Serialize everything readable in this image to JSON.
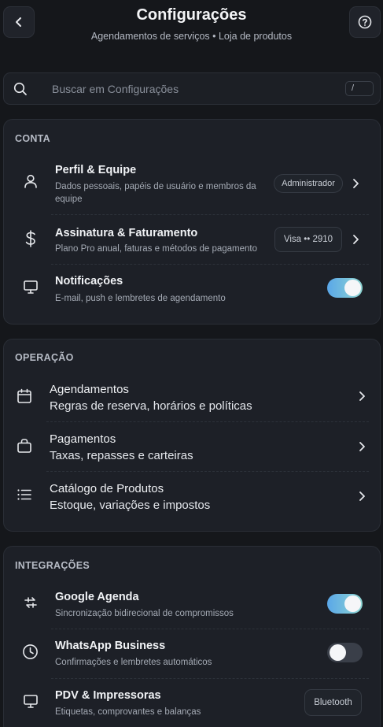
{
  "header": {
    "title": "Configurações",
    "subtitle": "Agendamentos de serviços • Loja de produtos"
  },
  "search": {
    "placeholder": "Buscar em Configurações",
    "shortcut": "/"
  },
  "conta": {
    "section_title": "CONTA",
    "items": [
      {
        "title": "Perfil & Equipe",
        "desc_line1": "Dados pessoais, papéis de usuário e membros da",
        "desc_line2": "equipe",
        "badge": "Administrador",
        "icon": "user-icon"
      },
      {
        "title": "Assinatura & Faturamento",
        "desc": "Plano Pro anual, faturas e métodos de pagamento",
        "badge": "Visa •• 2910",
        "icon": "dollar-icon"
      },
      {
        "title": "Notificações",
        "desc": "E-mail, push e lembretes de agendamento",
        "toggle_on": true,
        "icon": "monitor-icon"
      }
    ]
  },
  "operacao": {
    "section_title": "OPERAÇÃO",
    "items": [
      {
        "title": "Agendamentos",
        "desc": "Regras de reserva, horários e políticas",
        "icon": "calendar-icon"
      },
      {
        "title": "Pagamentos",
        "desc": "Taxas, repasses e carteiras",
        "icon": "bag-icon"
      },
      {
        "title": "Catálogo de Produtos",
        "desc": "Estoque, variações e impostos",
        "icon": "list-icon"
      }
    ]
  },
  "integracoes": {
    "section_title": "INTEGRAÇÕES",
    "items": [
      {
        "title": "Google Agenda",
        "desc": "Sincronização bidirecional de compromissos",
        "toggle_on": true,
        "icon": "sync-icon"
      },
      {
        "title": "WhatsApp Business",
        "desc": "Confirmações e lembretes automáticos",
        "toggle_on": false,
        "icon": "clock-icon"
      },
      {
        "title": "PDV & Impressoras",
        "desc": "Etiquetas, comprovantes e balanças",
        "badge": "Bluetooth",
        "icon": "monitor-icon"
      }
    ]
  }
}
